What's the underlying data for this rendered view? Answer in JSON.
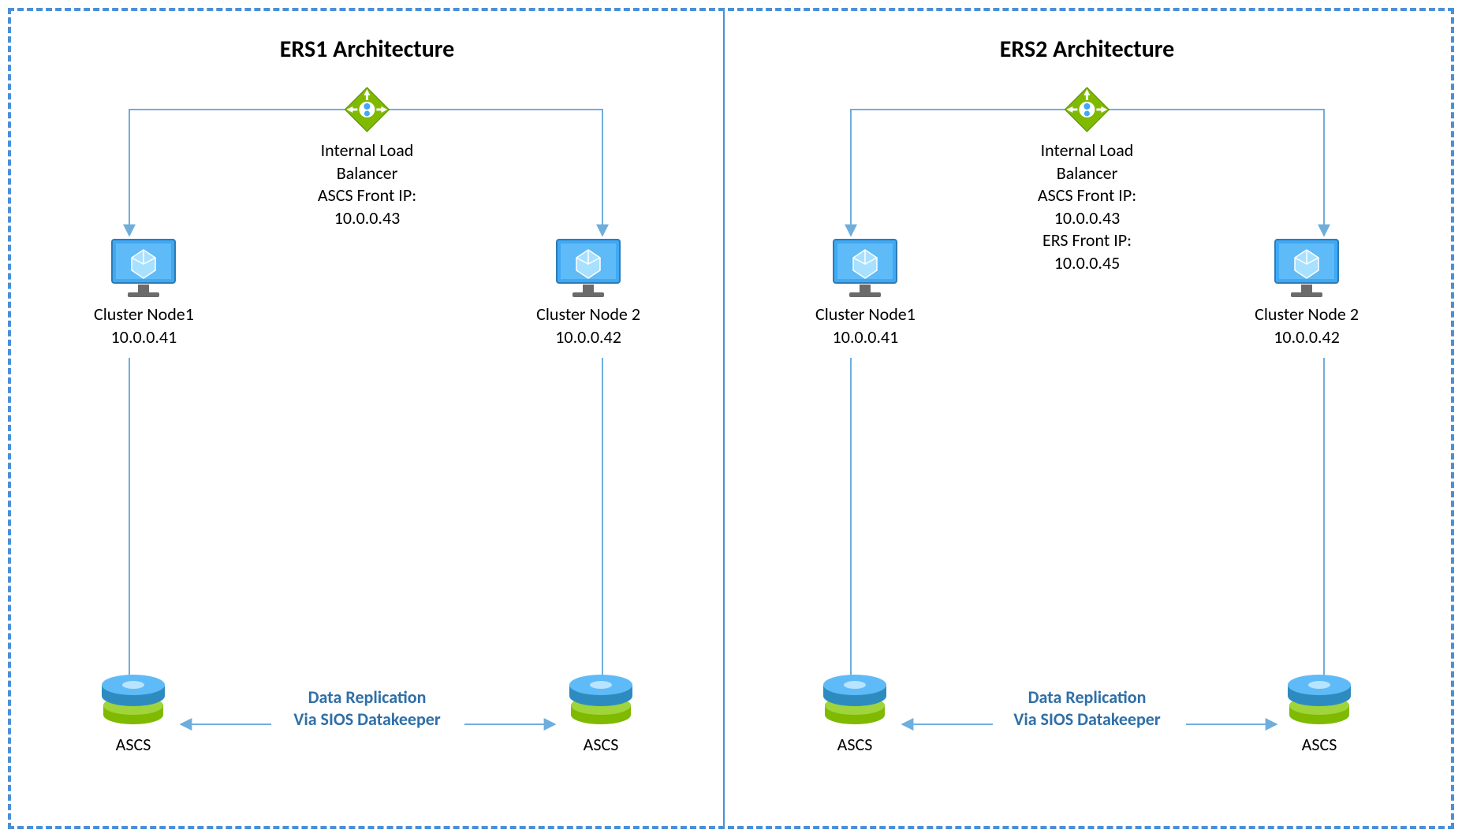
{
  "ers1": {
    "title": "ERS1 Architecture",
    "lb": {
      "line1": "Internal Load",
      "line2": "Balancer",
      "line3": "ASCS Front IP:",
      "line4": "10.0.0.43"
    },
    "node1": {
      "name": "Cluster Node1",
      "ip": "10.0.0.41"
    },
    "node2": {
      "name": "Cluster Node 2",
      "ip": "10.0.0.42"
    },
    "disk1": "ASCS",
    "disk2": "ASCS",
    "replication": {
      "line1": "Data Replication",
      "line2": "Via SIOS Datakeeper"
    }
  },
  "ers2": {
    "title": "ERS2 Architecture",
    "lb": {
      "line1": "Internal Load",
      "line2": "Balancer",
      "line3": "ASCS Front IP:",
      "line4": "10.0.0.43",
      "line5": "ERS Front IP:",
      "line6": "10.0.0.45"
    },
    "node1": {
      "name": "Cluster Node1",
      "ip": "10.0.0.41"
    },
    "node2": {
      "name": "Cluster Node 2",
      "ip": "10.0.0.42"
    },
    "disk1": "ASCS",
    "disk2": "ASCS",
    "replication": {
      "line1": "Data Replication",
      "line2": "Via SIOS Datakeeper"
    }
  }
}
